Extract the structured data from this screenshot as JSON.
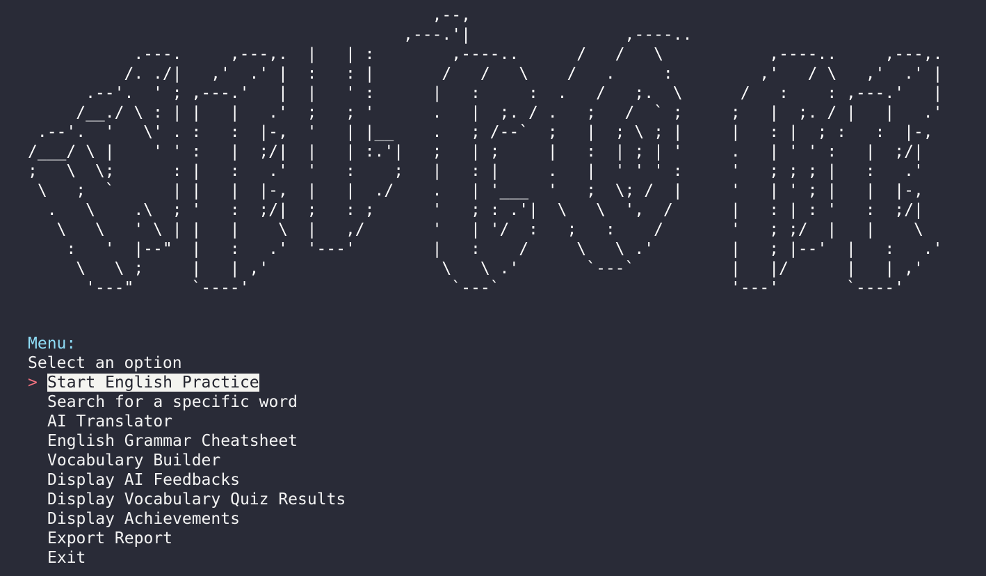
{
  "banner": {
    "art": "                                          ,--,\n                                       ,---.'|                ,----..                \n           .---.     ,---,.  |   | :        ,----..      /   /   \\           ,----..     ,---,.\n          /. ./|   ,'  .' |  :   : |       /   /   \\    /   .     :         ,'   / \\   ,'  .' |\n      .--'.  ' ; ,---.'   |  |   ' :      |   :     :  .   /   ;.  \\      /   :    : ,---.'   |\n     /__./ \\ : | |   |   .'  ;   ; '      .   |  ;. / .   ;   /  ` ;     ;   |  ;. / |   |   .'\n .--'.  '   \\' . :   :  |-,  '   | |__    .   ; /--`  ;   |  ; \\ ; |     |   : |  ; :   :  |-,\n/___/ \\ |    ' ' :   |  ;/|  |   | :.'|   ;   | ;     |   :  | ; | '     .   | ' ' :   |  ;/|\n;   \\  \\;      : |   :   .'  '   :    ;   |   : |     .   |  ' ' ' :     '   ; ; ; |   :   .'\n \\   ;  `      | |   |  |-,  |   |  ./    .   | '___  '   ;  \\; /  |     '   | ' ; |   |  |-,\n  .   \\    .\\  ; '   :  ;/|  ;   : ;      '   ; : .'|  \\   \\  ',  /      |   : | : '   :  ;/|\n   \\   \\   ' \\ | |   |    \\  |   ,/       '   | '/  :   ;   :    /       '   ; ;/  |   |    \\\n    :   '  |--\"  |   :   .'  '---'        |   :    /     \\   \\ .'        |   ; |--'  |   :   .'\n     \\   \\ ;     |   | ,'                  \\   \\ .'       `---`          |   |/      |   | ,'\n      '---\"      `----'                     `---`                        '---'       `----'"
  },
  "menu": {
    "heading": "Menu:",
    "subtitle": "Select an option",
    "cursor": ">",
    "selected_index": 0,
    "items": [
      {
        "label": "Start English Practice"
      },
      {
        "label": "Search for a specific word"
      },
      {
        "label": "AI Translator"
      },
      {
        "label": "English Grammar Cheatsheet"
      },
      {
        "label": "Vocabulary Builder"
      },
      {
        "label": "Display AI Feedbacks"
      },
      {
        "label": "Display Vocabulary Quiz Results"
      },
      {
        "label": "Display Achievements"
      },
      {
        "label": "Export Report"
      },
      {
        "label": "Exit"
      }
    ]
  },
  "colors": {
    "background": "#292b37",
    "text": "#f3f3f3",
    "heading": "#8fdcf6",
    "cursor": "#f2727f",
    "selection_background": "#f4f4f0",
    "selection_text": "#23242e"
  }
}
